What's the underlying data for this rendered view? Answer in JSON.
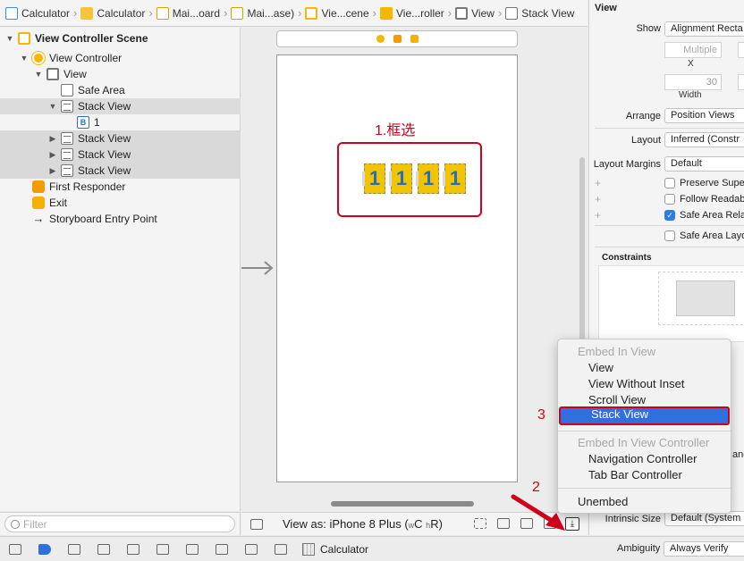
{
  "breadcrumb": [
    {
      "label": "Calculator",
      "icon": "project-file-icon"
    },
    {
      "label": "Calculator",
      "icon": "folder-icon"
    },
    {
      "label": "Mai...oard",
      "icon": "storyboard-icon"
    },
    {
      "label": "Mai...ase)",
      "icon": "storyboard-icon"
    },
    {
      "label": "Vie...cene",
      "icon": "scene-icon"
    },
    {
      "label": "Vie...roller",
      "icon": "view-controller-icon"
    },
    {
      "label": "View",
      "icon": "view-icon"
    },
    {
      "label": "Stack View",
      "icon": "stack-view-icon"
    }
  ],
  "outline": {
    "items": [
      {
        "label": "View Controller Scene"
      },
      {
        "label": "View Controller"
      },
      {
        "label": "View"
      },
      {
        "label": "Safe Area"
      },
      {
        "label": "Stack View"
      },
      {
        "label": "1"
      },
      {
        "label": "Stack View"
      },
      {
        "label": "Stack View"
      },
      {
        "label": "Stack View"
      },
      {
        "label": "First Responder"
      },
      {
        "label": "Exit"
      },
      {
        "label": "Storyboard Entry Point"
      }
    ],
    "filter_placeholder": "Filter"
  },
  "canvas": {
    "annotation_1": "1.框选",
    "annotation_2": "2",
    "annotation_3": "3",
    "tiles": [
      "1",
      "1",
      "1",
      "1"
    ],
    "view_as": "View as: iPhone 8 Plus (",
    "size_class_w": "w",
    "size_class_c": "C ",
    "size_class_h": "h",
    "size_class_r": "R)"
  },
  "inspector": {
    "section_title": "View",
    "show_label": "Show",
    "show_value": "Alignment Recta",
    "multiple_placeholder": "Multiple",
    "x_label": "X",
    "width_value": "30",
    "width_label": "Width",
    "arrange_label": "Arrange",
    "arrange_value": "Position Views",
    "layout_label": "Layout",
    "layout_value": "Inferred (Constr",
    "margins_label": "Layout Margins",
    "margins_value": "Default",
    "preserve_label": "Preserve Supe",
    "follow_label": "Follow Readab",
    "safe_rel_label": "Safe Area Rela",
    "safe_layout_label": "Safe Area Layo",
    "constraints_title": "Constraints",
    "anc_fragment": "anc",
    "intrinsic_label": "Intrinsic Size",
    "intrinsic_value": "Default (System",
    "ambiguity_label": "Ambiguity",
    "ambiguity_value": "Always Verify"
  },
  "embed_menu": {
    "header_1": "Embed In View",
    "items_1": [
      "View",
      "View Without Inset",
      "Scroll View",
      "Stack View"
    ],
    "header_2": "Embed In View Controller",
    "items_2": [
      "Navigation Controller",
      "Tab Bar Controller"
    ],
    "unembed": "Unembed"
  },
  "bottom": {
    "target_label": "Calculator"
  },
  "colors": {
    "annotation_red": "#d0021b",
    "menu_highlight": "#2f6fe0",
    "tile_yellow": "#f2c400"
  }
}
